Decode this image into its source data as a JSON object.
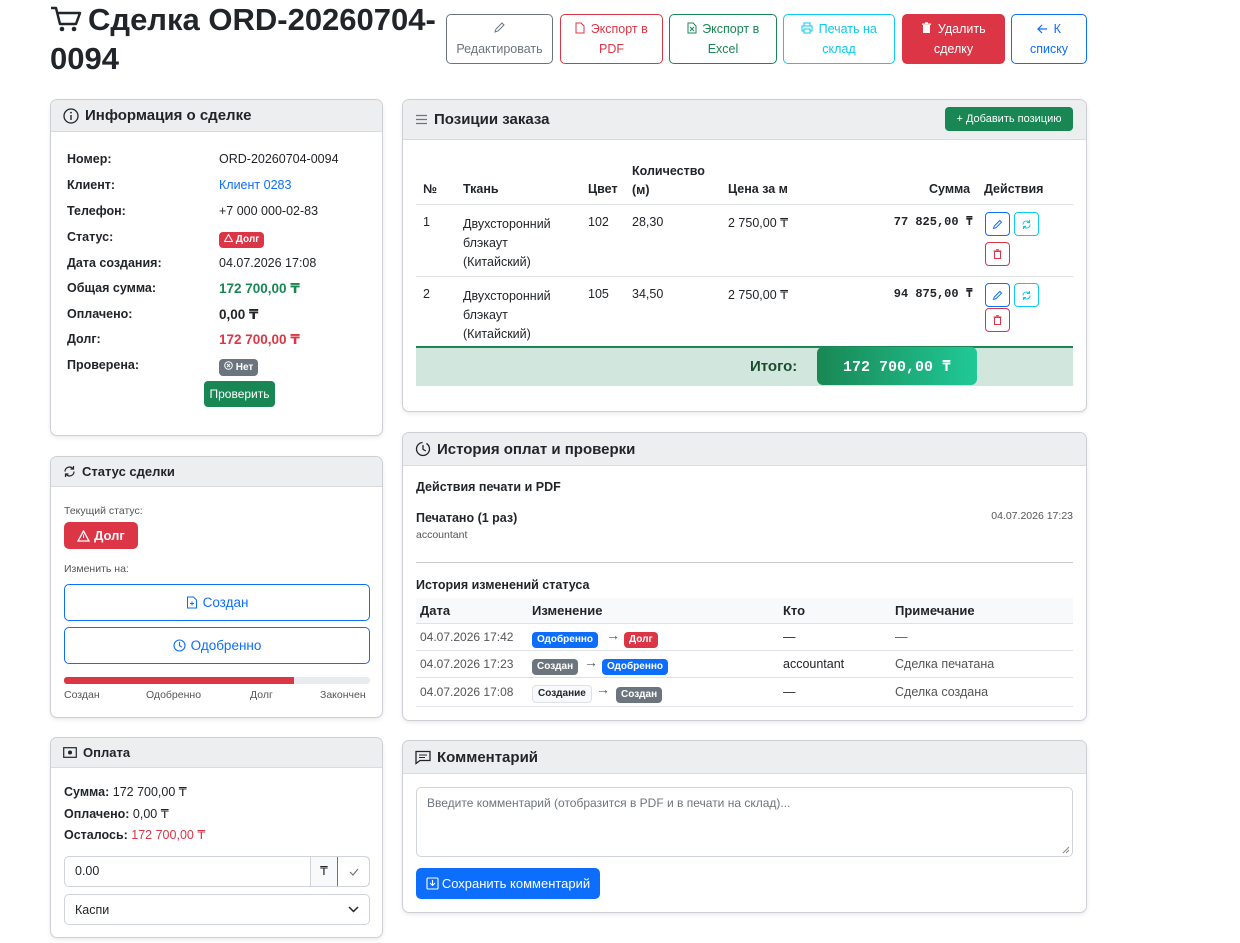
{
  "header": {
    "title": "Сделка ORD-20260704-0094",
    "buttons": {
      "edit": "Редактировать",
      "export_pdf": "Экспорт в PDF",
      "export_excel": "Экспорт в Excel",
      "print_warehouse": "Печать на склад",
      "delete": "Удалить сделку",
      "back": "К списку"
    }
  },
  "info": {
    "title": "Информация о сделке",
    "rows": [
      {
        "label": "Номер:",
        "value": "ORD-20260704-0094"
      },
      {
        "label": "Клиент:",
        "value": "Клиент 0283"
      },
      {
        "label": "Телефон:",
        "value": "+7 000 000-02-83"
      },
      {
        "label": "Статус:",
        "value": "Долг"
      },
      {
        "label": "Дата создания:",
        "value": "04.07.2026 17:08"
      },
      {
        "label": "Общая сумма:",
        "value": "172 700,00 ₸"
      },
      {
        "label": "Оплачено:",
        "value": "0,00 ₸"
      },
      {
        "label": "Долг:",
        "value": "172 700,00 ₸"
      },
      {
        "label": "Проверена:",
        "value": "Нет"
      }
    ],
    "verify_button": "Проверить"
  },
  "status_card": {
    "title": "Статус сделки",
    "current_label": "Текущий статус:",
    "current_value": "Долг",
    "change_label": "Изменить на:",
    "option_created": "Создан",
    "option_approved": "Одобренно",
    "progress_fraction": 0.75,
    "steps": [
      "Создан",
      "Одобренно",
      "Долг",
      "Закончен"
    ]
  },
  "payment": {
    "title": "Оплата",
    "sum_label": "Сумма:",
    "sum_value": "172 700,00 ₸",
    "paid_label": "Оплачено:",
    "paid_value": "0,00 ₸",
    "left_label": "Осталось:",
    "left_value": "172 700,00 ₸",
    "amount_input": "0.00",
    "currency": "₸",
    "method": "Каспи"
  },
  "orders": {
    "title": "Позиции заказа",
    "add_button": "Добавить позицию",
    "columns": [
      "№",
      "Ткань",
      "Цвет",
      "Количество (м)",
      "Цена за м",
      "Сумма",
      "Действия"
    ],
    "rows": [
      {
        "n": "1",
        "fabric": "Двухсторонний блэкаут (Китайский)",
        "color": "102",
        "qty": "28,30",
        "price": "2 750,00 ₸",
        "sum": "77 825,00 ₸"
      },
      {
        "n": "2",
        "fabric": "Двухсторонний блэкаут (Китайский)",
        "color": "105",
        "qty": "34,50",
        "price": "2 750,00 ₸",
        "sum": "94 875,00 ₸"
      }
    ],
    "total_label": "Итого:",
    "total_value": "172 700,00 ₸"
  },
  "history": {
    "title": "История оплат и проверки",
    "print_section": "Действия печати и PDF",
    "print_event": "Печатано (1 раз)",
    "print_user": "accountant",
    "print_time": "04.07.2026 17:23",
    "status_section": "История изменений статуса",
    "columns": [
      "Дата",
      "Изменение",
      "Кто",
      "Примечание"
    ],
    "rows": [
      {
        "date": "04.07.2026 17:42",
        "from": "Одобренно",
        "to": "Долг",
        "who": "—",
        "note": "—"
      },
      {
        "date": "04.07.2026 17:23",
        "from": "Создан",
        "to": "Одобренно",
        "who": "accountant",
        "note": "Сделка печатана"
      },
      {
        "date": "04.07.2026 17:08",
        "from": "Создание",
        "to": "Создан",
        "who": "—",
        "note": "Сделка создана"
      }
    ]
  },
  "comment": {
    "title": "Комментарий",
    "placeholder": "Введите комментарий (отобразится в PDF и в печати на склад)...",
    "save_button": "Сохранить комментарий"
  },
  "colors": {
    "primary": "#0d6efd",
    "danger": "#dc3545",
    "success": "#198754",
    "info": "#0dcaf0",
    "secondary": "#6c757d"
  }
}
